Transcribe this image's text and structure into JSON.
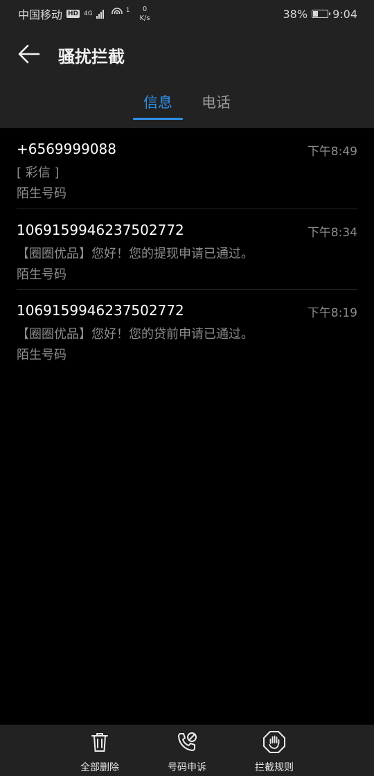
{
  "status_bar": {
    "carrier": "中国移动",
    "hd": "HD",
    "network": "4G",
    "wifi_sup": "1",
    "speed_value": "0",
    "speed_unit": "K/s",
    "battery_percent": "38%",
    "battery_level": 0.38,
    "time": "9:04"
  },
  "header": {
    "title": "骚扰拦截",
    "back_icon": "arrow-left-icon"
  },
  "tabs": [
    {
      "label": "信息",
      "active": true
    },
    {
      "label": "电话",
      "active": false
    }
  ],
  "messages": [
    {
      "number": "+6569999088",
      "time": "下午8:49",
      "preview": "[ 彩信 ]",
      "tag": "陌生号码"
    },
    {
      "number": "1069159946237502772",
      "time": "下午8:34",
      "preview": "【圈圈优品】您好！您的提现申请已通过。",
      "tag": "陌生号码"
    },
    {
      "number": "1069159946237502772",
      "time": "下午8:19",
      "preview": "【圈圈优品】您好！您的贷前申请已通过。",
      "tag": "陌生号码"
    }
  ],
  "toolbar": {
    "delete_all": {
      "label": "全部删除",
      "icon": "trash-icon"
    },
    "appeal": {
      "label": "号码申诉",
      "icon": "phone-blocked-icon"
    },
    "rules": {
      "label": "拦截规则",
      "icon": "hand-stop-icon"
    }
  },
  "colors": {
    "accent": "#2f8fe6",
    "bar_background": "#222222",
    "background": "#000000",
    "secondary_text": "#8c8c8c"
  }
}
